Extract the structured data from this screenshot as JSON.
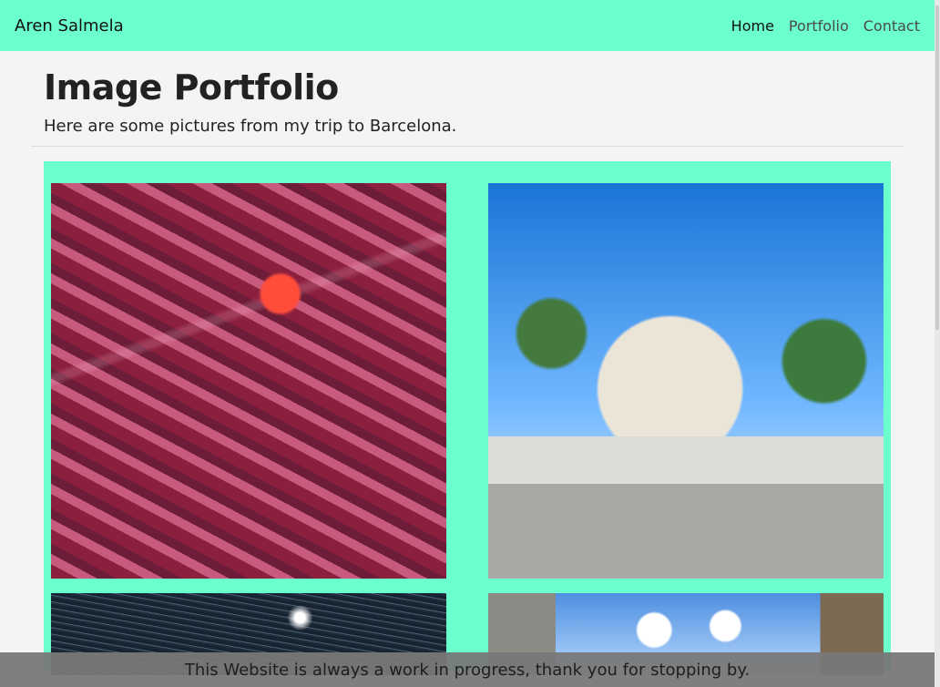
{
  "navbar": {
    "brand": "Aren Salmela",
    "links": [
      {
        "label": "Home"
      },
      {
        "label": "Portfolio"
      },
      {
        "label": "Contact"
      }
    ]
  },
  "header": {
    "title": "Image Portfolio",
    "subtitle": "Here are some pictures from my trip to Barcelona."
  },
  "footer": {
    "text": "This Website is always a work in progress, thank you for stopping by."
  },
  "colors": {
    "accent": "#6bffcd",
    "background": "#f4f4f4",
    "footer": "#787878"
  }
}
